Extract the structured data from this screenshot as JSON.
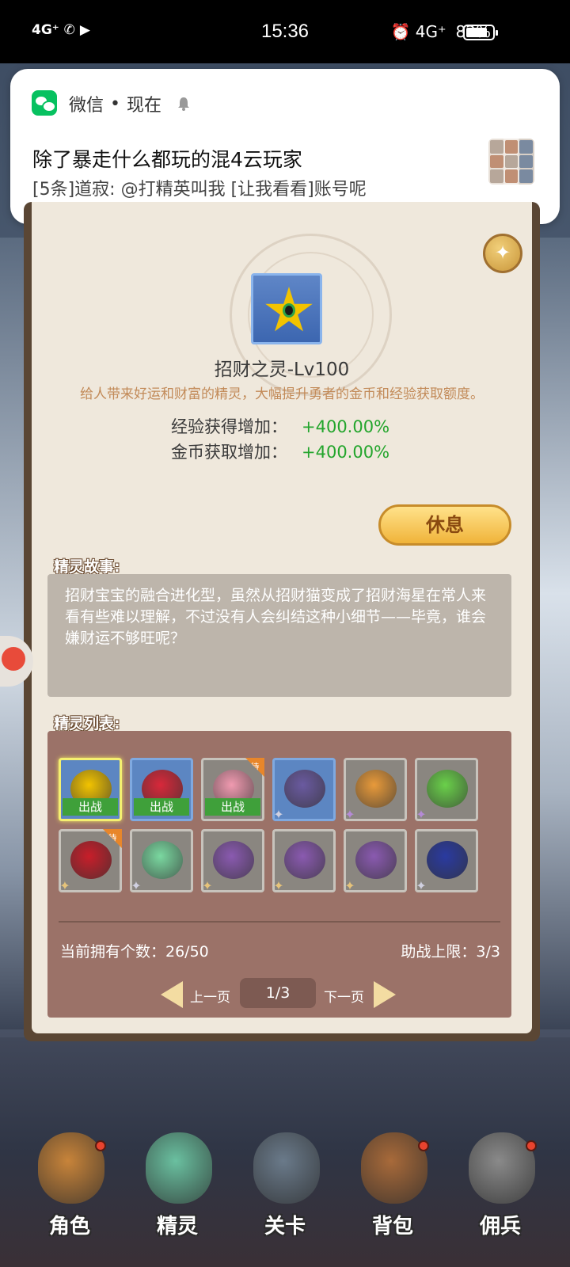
{
  "status_bar": {
    "time": "15:36",
    "left_indicators": "4G⁺ ✆ ▶",
    "right_indicators": "⏰ 4G⁺",
    "battery": "82%",
    "battery_level": 0.82
  },
  "notification": {
    "app_name": "微信",
    "separator": "•",
    "time": "现在",
    "title": "除了暴走什么都玩的混4云玩家",
    "body": "[5条]道寂: @打精英叫我 [让我看看]账号呢"
  },
  "sprite": {
    "name": "招财之灵-Lv100",
    "description": "给人带来好运和财富的精灵，大幅提升勇者的金币和经验获取额度。",
    "stats": [
      {
        "label": "经验获得增加：",
        "value": "+400.00%"
      },
      {
        "label": "金币获取增加：",
        "value": "+400.00%"
      }
    ],
    "rest_button": "休息"
  },
  "story": {
    "heading": "精灵故事:",
    "text": "招财宝宝的融合进化型，虽然从招财猫变成了招财海星在常人来看有些难以理解，不过没有人会纠结这种小细节——毕竟，谁会嫌财运不够旺呢？"
  },
  "sprite_list": {
    "heading": "精灵列表:",
    "out_label": "出战",
    "wait_label": "待",
    "items": [
      {
        "color": "#f2c300",
        "bg": "blue",
        "out": true,
        "selected": true
      },
      {
        "color": "#d8283a",
        "bg": "blue",
        "out": true
      },
      {
        "color": "#f09ab0",
        "bg": "gray",
        "out": true,
        "wait": true
      },
      {
        "color": "#6a5aa0",
        "bg": "blue",
        "rank": "silver"
      },
      {
        "color": "#e89a3a",
        "bg": "gray",
        "rank": "purple"
      },
      {
        "color": "#6ad04a",
        "bg": "gray",
        "rank": "purple"
      },
      {
        "color": "#c81e2a",
        "bg": "gray",
        "wait": true,
        "rank": "gold"
      },
      {
        "color": "#7ad8a0",
        "bg": "gray",
        "rank": "silver"
      },
      {
        "color": "#8a5ab0",
        "bg": "gray",
        "rank": "gold"
      },
      {
        "color": "#8a5ab0",
        "bg": "gray",
        "rank": "gold"
      },
      {
        "color": "#8a5ab0",
        "bg": "gray",
        "rank": "gold"
      },
      {
        "color": "#2a3aa0",
        "bg": "gray",
        "rank": "silver"
      }
    ],
    "owned_count": "当前拥有个数：26/50",
    "assist_limit": "助战上限：3/3",
    "prev_label": "上一页",
    "next_label": "下一页",
    "page": "1/3"
  },
  "bottom_nav": [
    {
      "label": "角色",
      "dot": true,
      "color": "#c8843a"
    },
    {
      "label": "精灵",
      "dot": false,
      "color": "#6ac0a0"
    },
    {
      "label": "关卡",
      "dot": false,
      "color": "#6a7a8a"
    },
    {
      "label": "背包",
      "dot": true,
      "color": "#a86a3a"
    },
    {
      "label": "佣兵",
      "dot": true,
      "color": "#8a8a8a"
    }
  ],
  "colors": {
    "accent_green": "#23a52c",
    "notification_brand": "#07c160",
    "button_gold": "#f0b43a"
  }
}
